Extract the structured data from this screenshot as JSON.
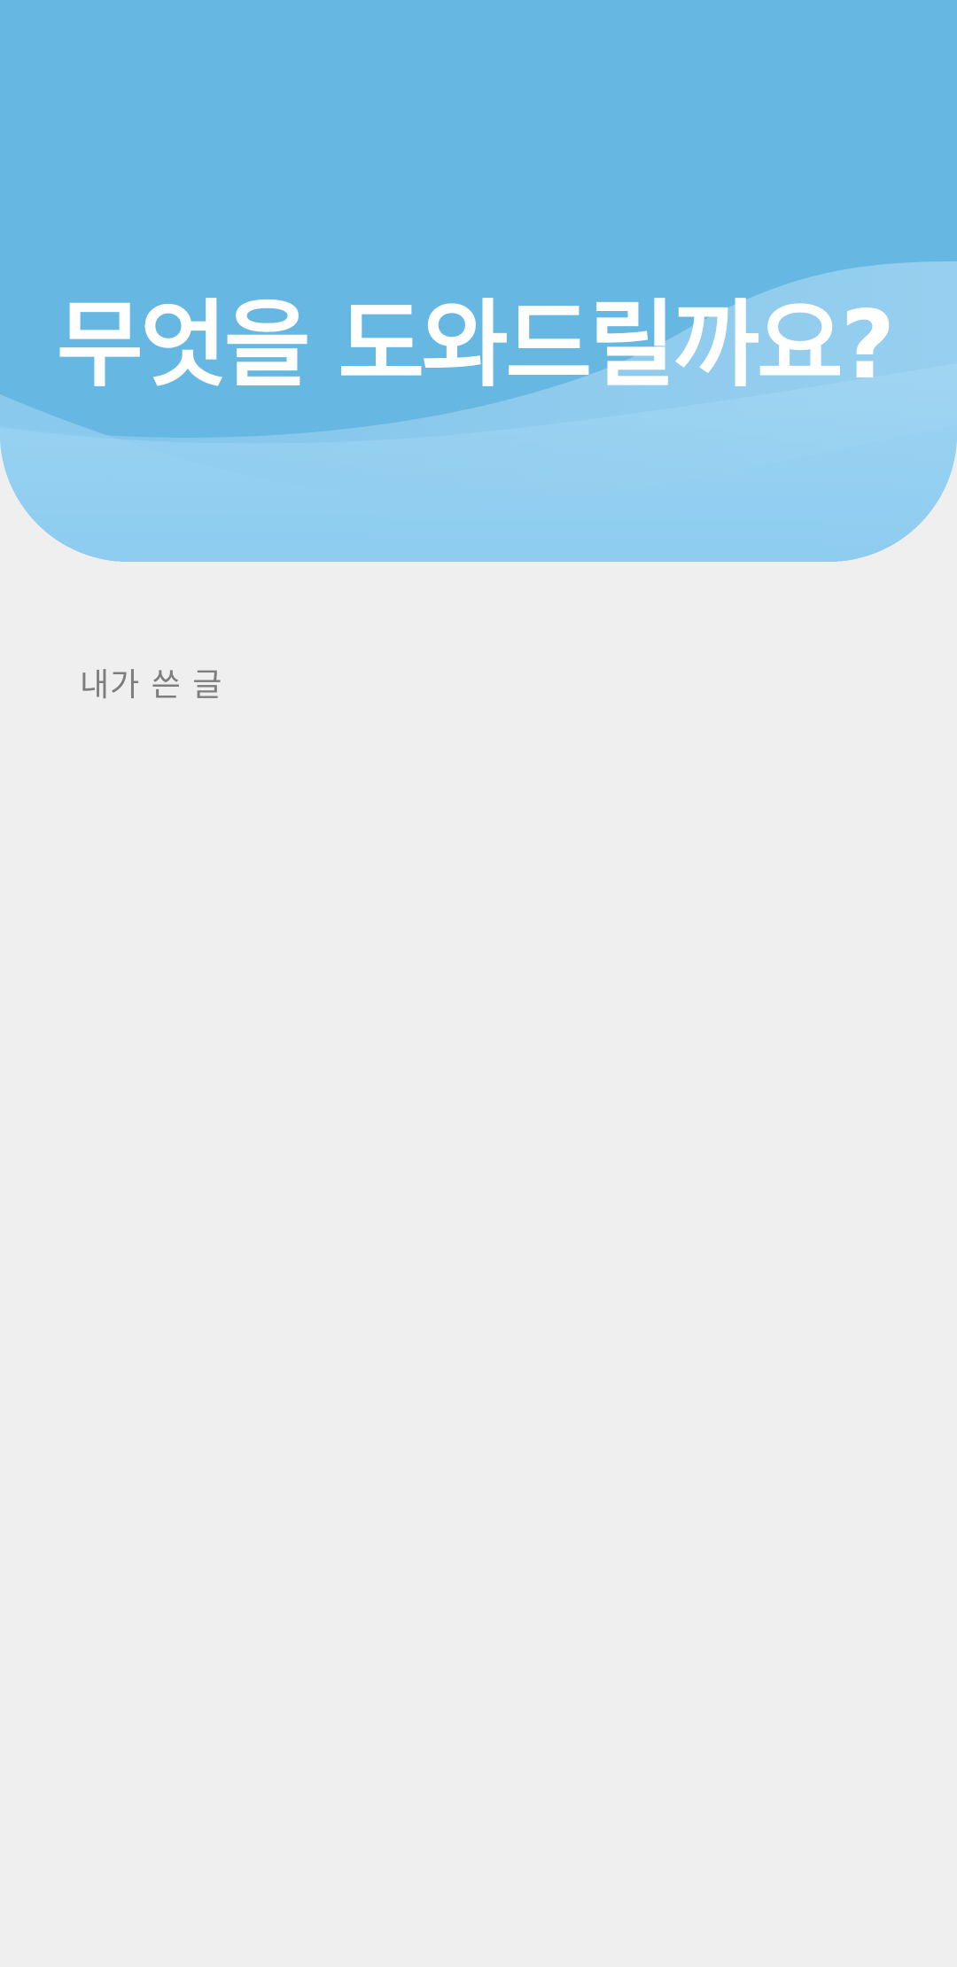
{
  "header": {
    "title": "무엇을 도와드릴까요?"
  },
  "section": {
    "my_posts_label": "내가 쓴 글"
  },
  "colors": {
    "hero_top": "#66b8e2",
    "hero_bottom": "#93cff1",
    "background": "#efefef",
    "title_text": "#ffffff",
    "label_text": "#7d7d7d"
  }
}
